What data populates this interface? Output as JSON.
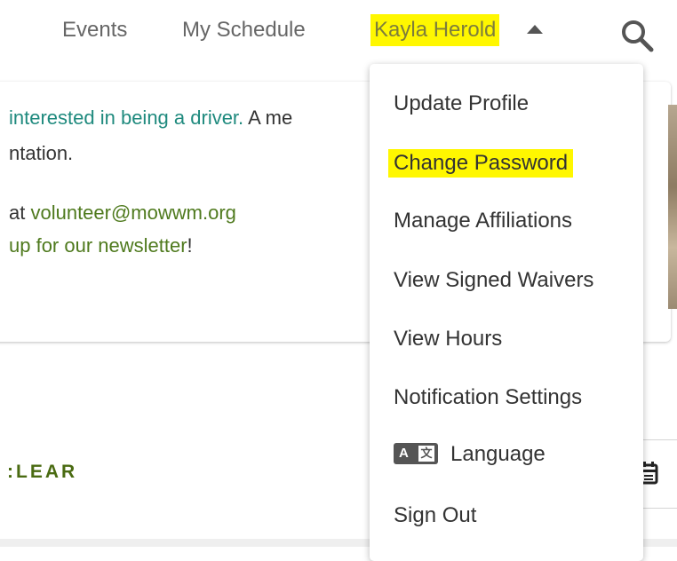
{
  "nav": {
    "events": "Events",
    "my_schedule": "My Schedule",
    "user_name": "Kayla Herold",
    "caret_icon": "caret-up-icon",
    "search_icon": "search-icon",
    "highlight_color": "#fff700"
  },
  "content": {
    "line1_link": "interested in being a driver.",
    "line1_rest": " A me",
    "line2": "ntation.",
    "line3_prefix": "at ",
    "line3_link": "volunteer@mowwm.org",
    "line4_link": " up for our newsletter",
    "line4_suffix": "!",
    "link_color": "#4f7a1e",
    "teal_color": "#1f8a7e"
  },
  "filters": {
    "clear_label": ":LEAR",
    "calendar_icon": "calendar-icon"
  },
  "dropdown": {
    "items": [
      {
        "label": "Update Profile"
      },
      {
        "label": "Change Password",
        "highlighted": true
      },
      {
        "label": "Manage Affiliations"
      },
      {
        "label": "View Signed Waivers"
      },
      {
        "label": "View Hours"
      },
      {
        "label": "Notification Settings"
      },
      {
        "label": "Language",
        "icon": "translate-icon",
        "icon_text_a": "A",
        "icon_text_b": "文"
      },
      {
        "label": "Sign Out"
      }
    ]
  }
}
